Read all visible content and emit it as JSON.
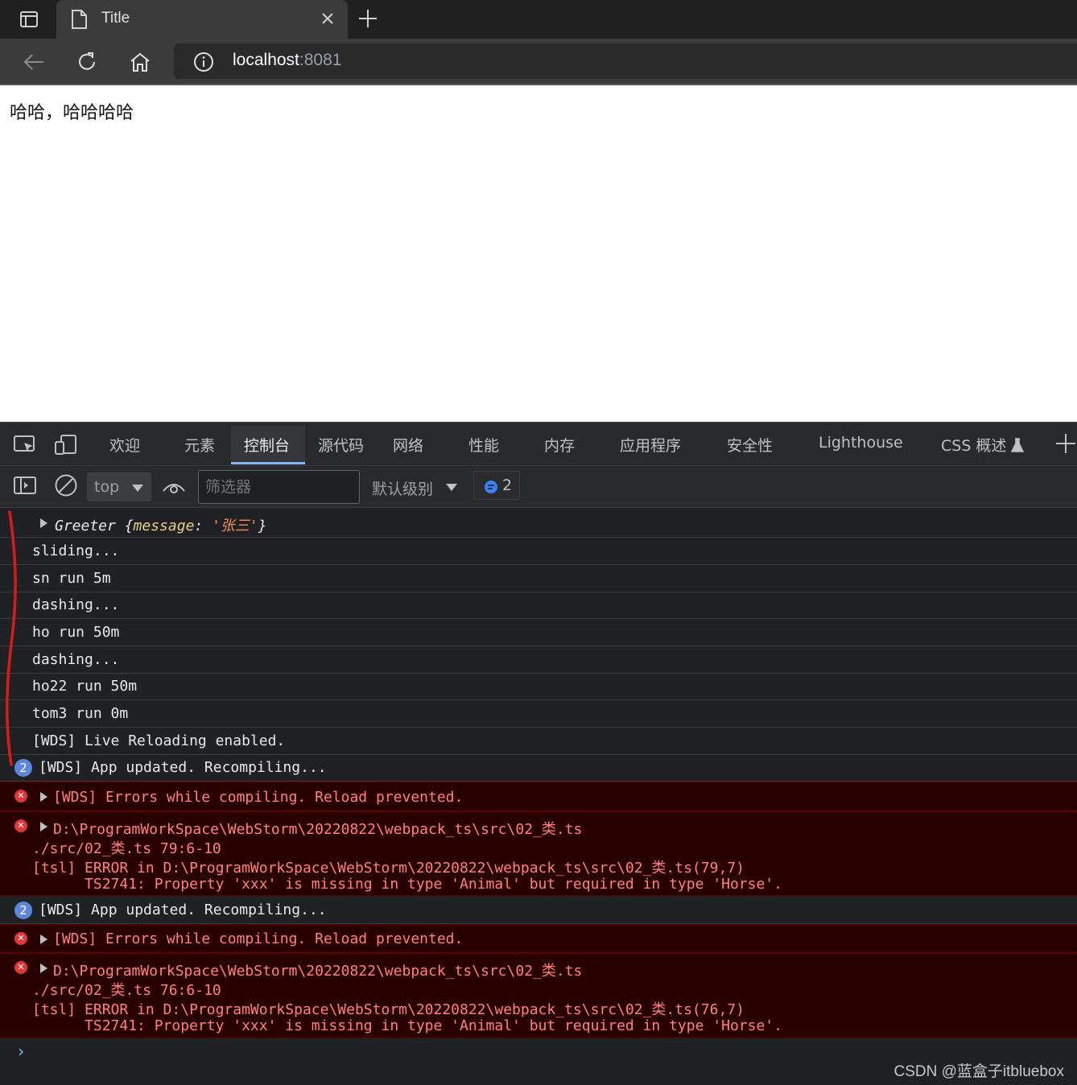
{
  "browser": {
    "tab_title": "Title",
    "url_host": "localhost",
    "url_port": ":8081",
    "icons": [
      "sidebar-icon",
      "page-icon",
      "close-icon",
      "plus-icon",
      "back-icon",
      "refresh-icon",
      "home-icon",
      "info-icon"
    ]
  },
  "page": {
    "text": "哈哈，哈哈哈哈"
  },
  "devtools": {
    "tabs": [
      "欢迎",
      "元素",
      "控制台",
      "源代码",
      "网络",
      "性能",
      "内存",
      "应用程序",
      "安全性",
      "Lighthouse",
      "CSS 概述"
    ],
    "active_tab": "控制台",
    "context": "top",
    "filter_placeholder": "筛选器",
    "level": "默认级别",
    "message_count": "2"
  },
  "console": {
    "object_log": {
      "name": "Greeter",
      "key": "message",
      "value": "'张三'"
    },
    "logs": [
      "sliding...",
      "sn run 5m",
      "dashing...",
      "ho run 50m",
      "dashing...",
      "ho22 run 50m",
      "tom3 run 0m",
      "[WDS] Live Reloading enabled."
    ],
    "group1": {
      "badge": "2",
      "info": "[WDS] App updated. Recompiling...",
      "err1": "[WDS] Errors while compiling. Reload prevented.",
      "err2_lines": [
        "D:\\ProgramWorkSpace\\WebStorm\\20220822\\webpack_ts\\src\\02_类.ts",
        "./src/02_类.ts 79:6-10",
        "[tsl] ERROR in D:\\ProgramWorkSpace\\WebStorm\\20220822\\webpack_ts\\src\\02_类.ts(79,7)",
        "      TS2741: Property 'xxx' is missing in type 'Animal' but required in type 'Horse'."
      ]
    },
    "group2": {
      "badge": "2",
      "info": "[WDS] App updated. Recompiling...",
      "err1": "[WDS] Errors while compiling. Reload prevented.",
      "err2_lines": [
        "D:\\ProgramWorkSpace\\WebStorm\\20220822\\webpack_ts\\src\\02_类.ts",
        "./src/02_类.ts 76:6-10",
        "[tsl] ERROR in D:\\ProgramWorkSpace\\WebStorm\\20220822\\webpack_ts\\src\\02_类.ts(76,7)",
        "      TS2741: Property 'xxx' is missing in type 'Animal' but required in type 'Horse'."
      ]
    },
    "prompt": "›"
  },
  "watermark": "CSDN @蓝盒子itbluebox",
  "colors": {
    "error_bg": "#290000",
    "error_text": "#ff8080",
    "annotation_red": "#d9191c",
    "active_tab_underline": "#8ab4f8"
  }
}
